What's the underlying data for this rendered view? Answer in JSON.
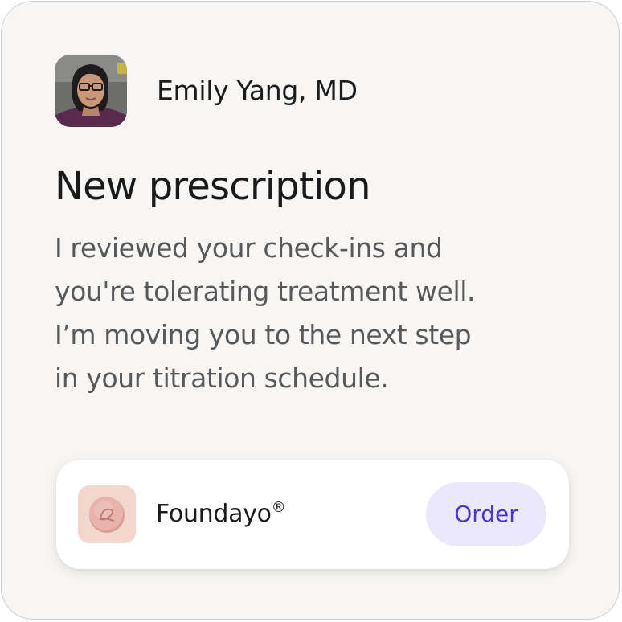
{
  "doctor": {
    "name": "Emily Yang, MD",
    "avatar_icon": "doctor-avatar-photo"
  },
  "message": {
    "title": "New prescription",
    "lines": [
      "I reviewed your check-ins and",
      "you're tolerating treatment well.",
      "I’m moving you to the next step",
      "in your titration schedule."
    ]
  },
  "medication": {
    "name": "Foundayo",
    "registered_mark": "®",
    "icon": "pill-icon",
    "order_label": "Order"
  },
  "colors": {
    "card_background": "#f7f6f4",
    "order_button_background": "#ebe8fc",
    "order_button_text": "#4a36cf",
    "pill_background": "#f1d7cd"
  }
}
